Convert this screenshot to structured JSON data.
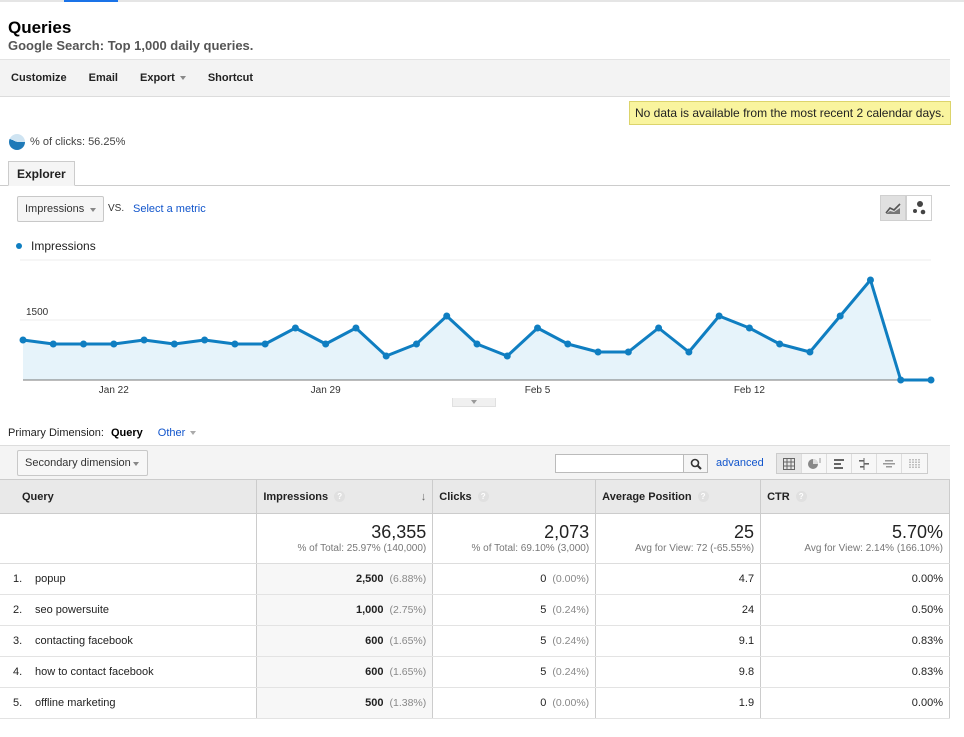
{
  "page": {
    "title": "Queries",
    "subtitle": "Google Search: Top 1,000 daily queries."
  },
  "toolbar": {
    "customize": "Customize",
    "email": "Email",
    "export": "Export",
    "shortcut": "Shortcut"
  },
  "notice": "No data is available from the most recent 2 calendar days.",
  "segment": {
    "label": "% of clicks: 56.25%",
    "percent": 56.25
  },
  "tabs": {
    "explorer": "Explorer"
  },
  "metric": {
    "selected": "Impressions",
    "vs": "VS.",
    "select_metric": "Select a metric"
  },
  "chart_controls": {
    "line": "line-chart-icon",
    "motion": "motion-chart-icon"
  },
  "chart_data": {
    "type": "area",
    "title": "",
    "legend": [
      "Impressions"
    ],
    "legend_position": "top-left",
    "color": "#0f7ec1",
    "fill": "#e6f3fa",
    "xlabel": "",
    "ylabel": "",
    "ylim": [
      0,
      3000
    ],
    "yticks": [
      1500,
      3000
    ],
    "xtick_labels": [
      {
        "label": "Jan 22",
        "index": 3
      },
      {
        "label": "Jan 29",
        "index": 10
      },
      {
        "label": "Feb 5",
        "index": 17
      },
      {
        "label": "Feb 12",
        "index": 24
      }
    ],
    "x": [
      "Jan 19",
      "Jan 20",
      "Jan 21",
      "Jan 22",
      "Jan 23",
      "Jan 24",
      "Jan 25",
      "Jan 26",
      "Jan 27",
      "Jan 28",
      "Jan 29",
      "Jan 30",
      "Jan 31",
      "Feb 1",
      "Feb 2",
      "Feb 3",
      "Feb 4",
      "Feb 5",
      "Feb 6",
      "Feb 7",
      "Feb 8",
      "Feb 9",
      "Feb 10",
      "Feb 11",
      "Feb 12",
      "Feb 13",
      "Feb 14",
      "Feb 15",
      "Feb 16",
      "Feb 17",
      "Feb 18"
    ],
    "series": [
      {
        "name": "Impressions",
        "values": [
          1000,
          900,
          900,
          900,
          1000,
          900,
          1000,
          900,
          900,
          1300,
          900,
          1300,
          600,
          900,
          1600,
          900,
          600,
          1300,
          900,
          700,
          700,
          1300,
          700,
          1600,
          1300,
          900,
          700,
          1600,
          2500,
          0,
          0
        ]
      }
    ]
  },
  "dimension": {
    "primary_label": "Primary Dimension:",
    "primary_value": "Query",
    "other": "Other",
    "secondary": "Secondary dimension"
  },
  "table_tools": {
    "search_value": "",
    "advanced": "advanced"
  },
  "table": {
    "headers": {
      "query": "Query",
      "impressions": "Impressions",
      "clicks": "Clicks",
      "avg_position": "Average Position",
      "ctr": "CTR"
    },
    "summary": {
      "impressions": "36,355",
      "impressions_sub": "% of Total: 25.97% (140,000)",
      "clicks": "2,073",
      "clicks_sub": "% of Total: 69.10% (3,000)",
      "avg_position": "25",
      "avg_position_sub": "Avg for View: 72 (-65.55%)",
      "ctr": "5.70%",
      "ctr_sub": "Avg for View: 2.14% (166.10%)"
    },
    "rows": [
      {
        "index": "1.",
        "query": "popup",
        "impressions": "2,500",
        "impressions_pct": "(6.88%)",
        "clicks": "0",
        "clicks_pct": "(0.00%)",
        "avg_position": "4.7",
        "ctr": "0.00%"
      },
      {
        "index": "2.",
        "query": "seo powersuite",
        "impressions": "1,000",
        "impressions_pct": "(2.75%)",
        "clicks": "5",
        "clicks_pct": "(0.24%)",
        "avg_position": "24",
        "ctr": "0.50%"
      },
      {
        "index": "3.",
        "query": "contacting facebook",
        "impressions": "600",
        "impressions_pct": "(1.65%)",
        "clicks": "5",
        "clicks_pct": "(0.24%)",
        "avg_position": "9.1",
        "ctr": "0.83%"
      },
      {
        "index": "4.",
        "query": "how to contact facebook",
        "impressions": "600",
        "impressions_pct": "(1.65%)",
        "clicks": "5",
        "clicks_pct": "(0.24%)",
        "avg_position": "9.8",
        "ctr": "0.83%"
      },
      {
        "index": "5.",
        "query": "offline marketing",
        "impressions": "500",
        "impressions_pct": "(1.38%)",
        "clicks": "0",
        "clicks_pct": "(0.00%)",
        "avg_position": "1.9",
        "ctr": "0.00%"
      }
    ]
  }
}
